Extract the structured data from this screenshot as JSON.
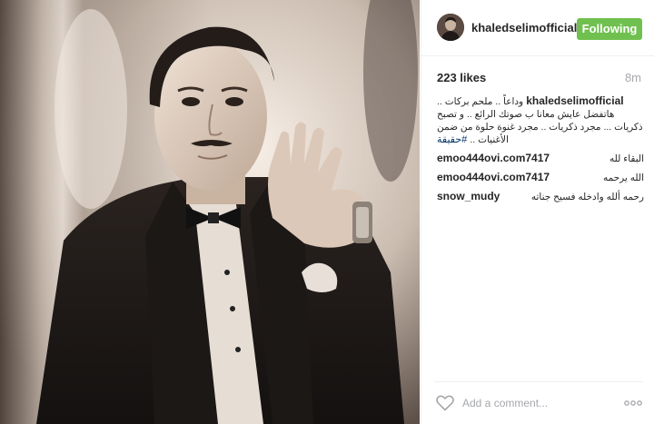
{
  "post": {
    "username": "khaledselimofficial",
    "follow_label": "Following",
    "likes": "223 likes",
    "time_ago": "8m",
    "caption": {
      "user": "khaledselimofficial",
      "text": "وداعاً .. ملحم بركات .. هاتفضل عايش معانا ب صوتك الرائع .. و تصبح ذكريات ... مجرد ذكريات .. مجرد غنوة حلوة من ضمن الأغنيات ..",
      "hashtag": "#حقيقة"
    },
    "comments": [
      {
        "user": "emoo444ovi.com7417",
        "text": "البقاء لله"
      },
      {
        "user": "emoo444ovi.com7417",
        "text": "الله يرحمه"
      },
      {
        "user": "snow_mudy",
        "text": "رحمه ألله وادخله فسيح جناته"
      }
    ],
    "add_comment_placeholder": "Add a comment...",
    "colors": {
      "follow": "#70c050",
      "link": "#003569",
      "muted": "#a5a7aa"
    },
    "icons": {
      "like": "heart-outline-icon",
      "options": "more-dots-icon"
    }
  }
}
